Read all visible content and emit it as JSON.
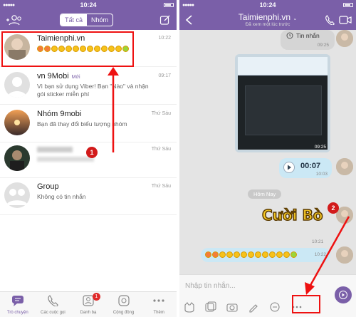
{
  "left": {
    "status_time": "10:24",
    "tabs": {
      "all": "Tất cả",
      "group": "Nhóm"
    },
    "chats": [
      {
        "name": "Taimienphi.vn",
        "time": "10:22",
        "snippet": "",
        "new": ""
      },
      {
        "name": "vn 9Mobi",
        "time": "09:17",
        "new": "Mới",
        "snippet": "Vì bạn sử dụng Viber! Bạn \"Nào\" và nhận gói sticker miễn phí"
      },
      {
        "name": "Nhóm 9mobi",
        "time": "Thứ Sáu",
        "new": "",
        "snippet": "Bạn đã thay đổi biểu tượng nhóm"
      },
      {
        "name": "",
        "time": "Thứ Sáu",
        "new": "",
        "snippet": ""
      },
      {
        "name": "Group",
        "time": "Thứ Sáu",
        "new": "",
        "snippet": "Không có tin nhắn"
      }
    ],
    "annotation_1": "1",
    "tabbar": [
      {
        "label": "Trò chuyện",
        "icon": "chat-icon"
      },
      {
        "label": "Các cuộc gọi",
        "icon": "phone-icon"
      },
      {
        "label": "Danh bạ",
        "icon": "contacts-icon",
        "badge": "1"
      },
      {
        "label": "Cộng đồng",
        "icon": "community-icon"
      },
      {
        "label": "Thêm",
        "icon": "more-icon"
      }
    ]
  },
  "right": {
    "status_time": "10:24",
    "title": "Taimienphi.vn",
    "subtitle": "Đã xem một lúc trước",
    "voice_label": "Tin nhắn",
    "voice_time": "09:25",
    "video_duration": "09:25",
    "audio_length": "00:07",
    "audio_time": "10:03",
    "date_divider": "Hôm Nay",
    "sticker_text": "Cười Bò",
    "sticker_time": "10:21",
    "emoji_time": "10:22",
    "input_placeholder": "Nhập tin nhắn...",
    "annotation_2": "2"
  },
  "colors": {
    "viber_purple": "#7a5fa8",
    "annotation_red": "#e11"
  }
}
